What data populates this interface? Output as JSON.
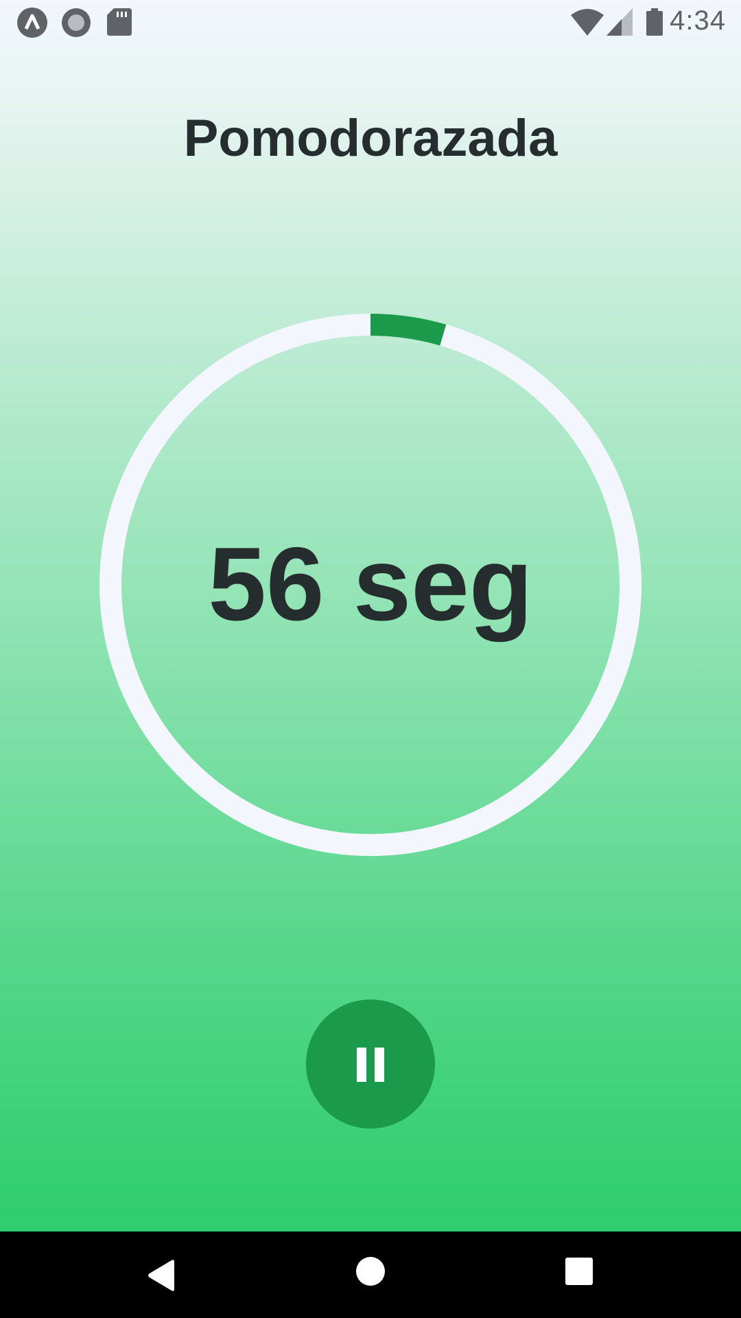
{
  "status_bar": {
    "time": "4:34",
    "left_icons": [
      "app-notification-icon",
      "record-icon",
      "sd-card-icon"
    ],
    "right_icons": [
      "wifi-icon",
      "signal-icon",
      "battery-icon"
    ]
  },
  "app": {
    "title": "Pomodorazada"
  },
  "timer": {
    "display": "56 seg",
    "progress_fraction": 0.045,
    "track_color": "#f3f6fd",
    "progress_color": "#1a9a4a"
  },
  "controls": {
    "pause_icon": "pause-icon",
    "button_color": "#1a9a4a"
  },
  "nav_bar": {
    "buttons": [
      "back-icon",
      "home-icon",
      "recents-icon"
    ]
  },
  "colors": {
    "text": "#262d2e",
    "gradient_top": "#f3f6fd",
    "gradient_bottom": "#2ecd6d"
  }
}
